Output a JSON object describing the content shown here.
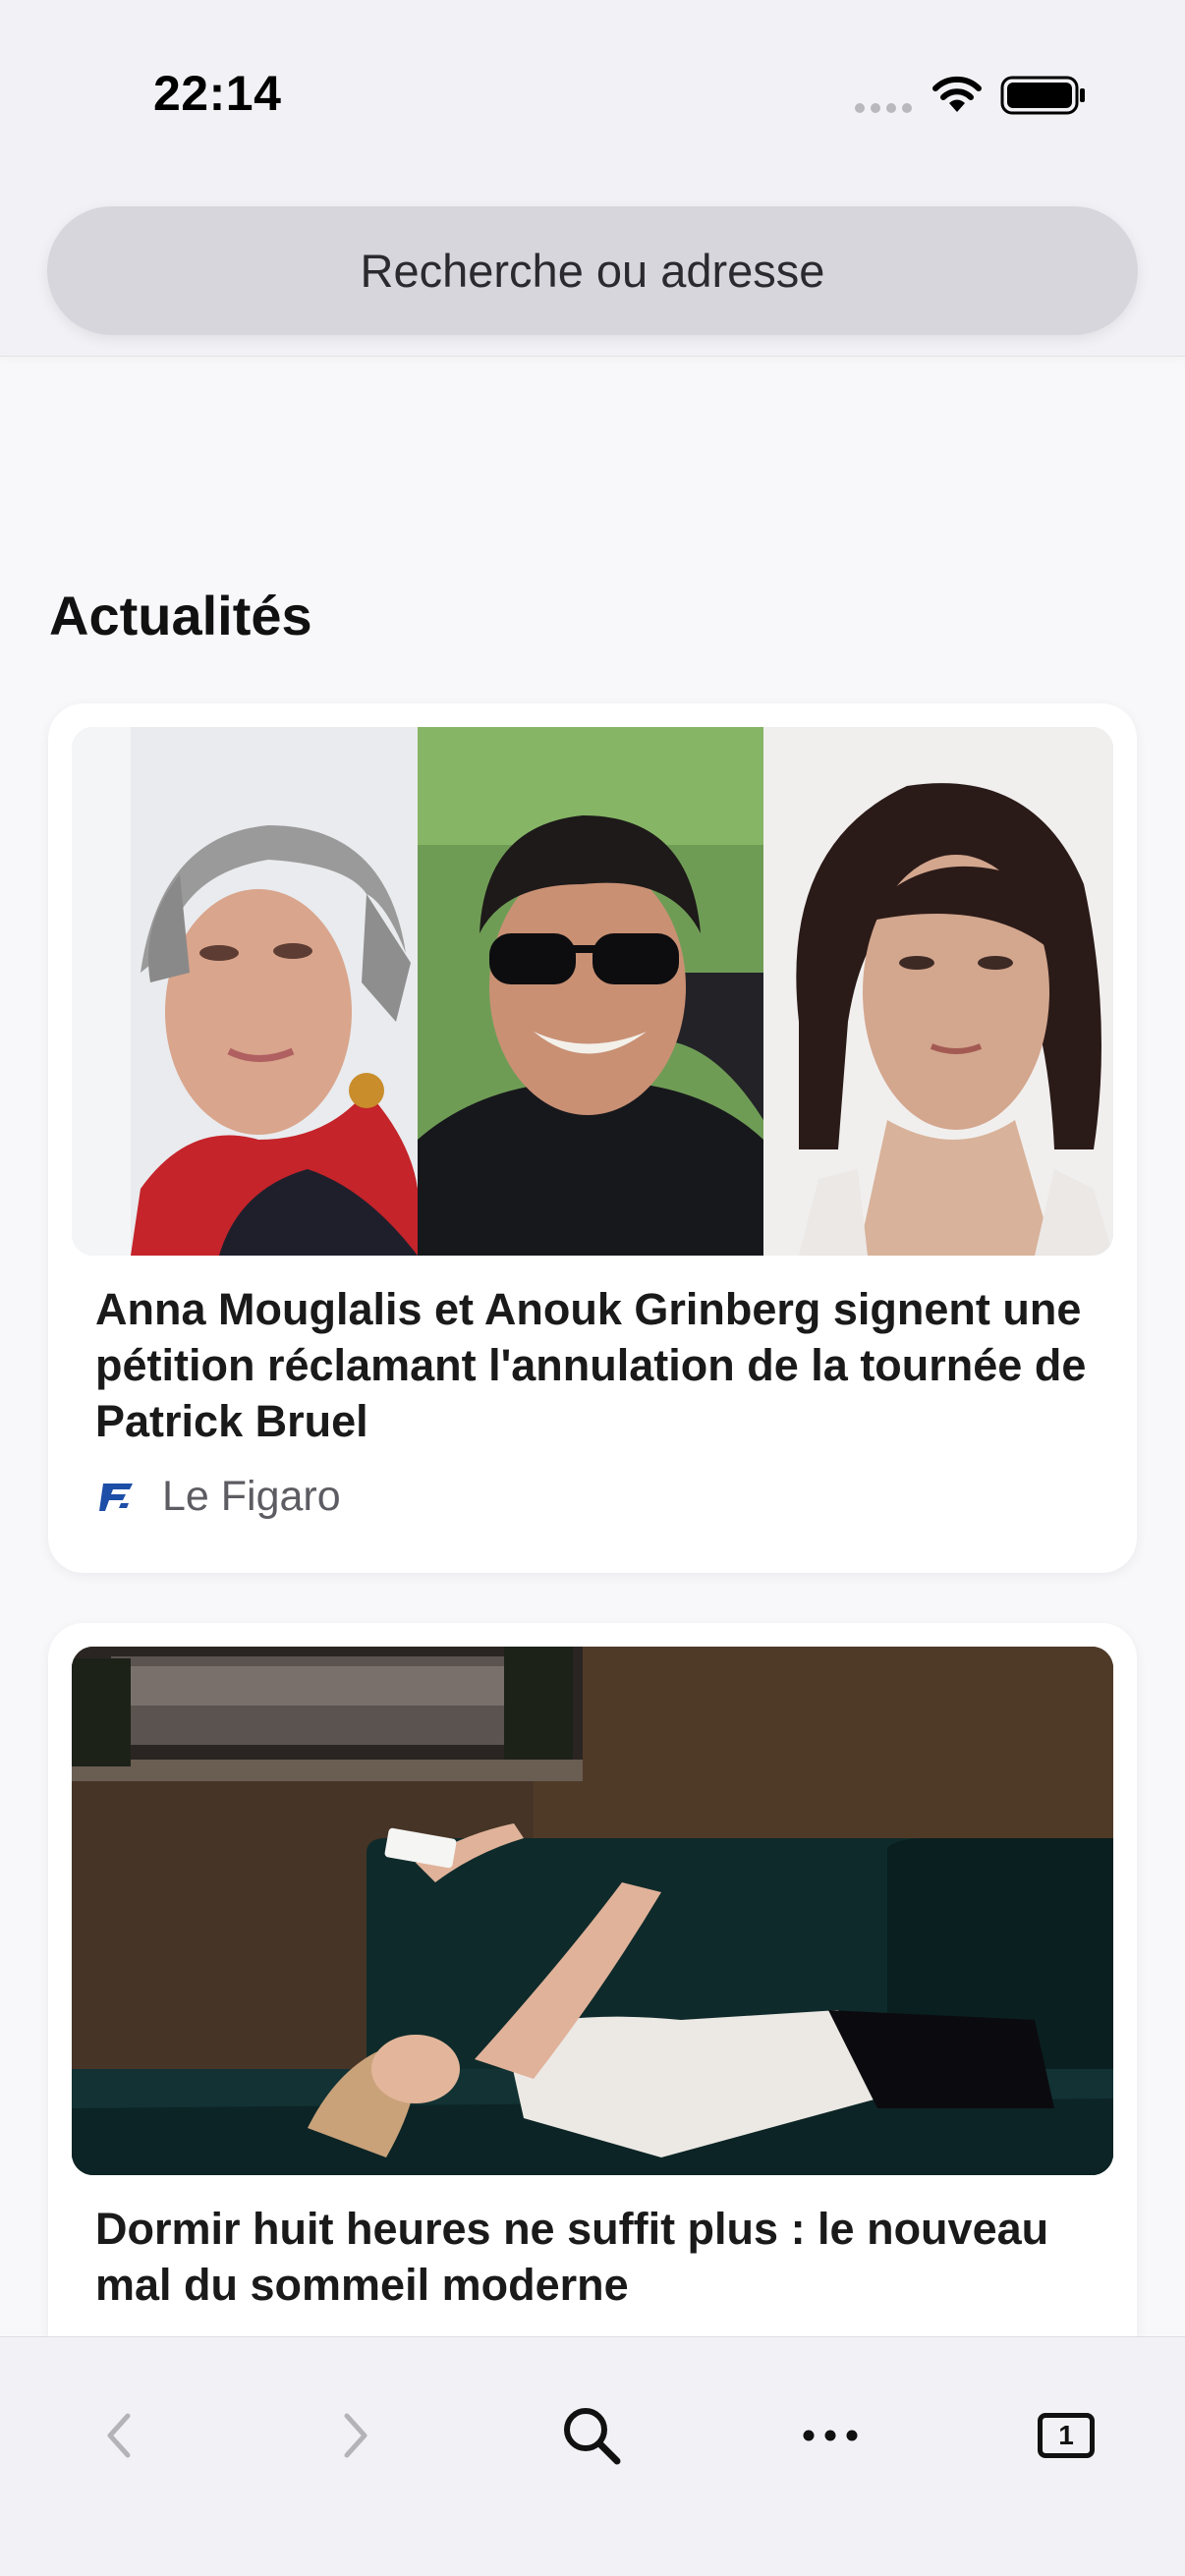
{
  "status_bar": {
    "time": "22:14",
    "icons": [
      "cellular-signal-icon",
      "wifi-icon",
      "battery-icon"
    ]
  },
  "address_bar": {
    "placeholder": "Recherche ou adresse"
  },
  "news": {
    "section_title": "Actualités",
    "articles": [
      {
        "headline": "Anna Mouglalis et Anouk Grinberg signent une pétition réclamant l'annulation de la tournée de Patrick Bruel",
        "source": "Le Figaro",
        "source_icon": "le-figaro-logo-icon",
        "image": "three-portraits-photo"
      },
      {
        "headline": "Dormir huit heures ne suffit plus : le nouveau mal du sommeil moderne",
        "image": "woman-lying-on-couch-with-phone-photo"
      }
    ]
  },
  "toolbar": {
    "buttons": [
      "back-icon",
      "forward-icon",
      "search-icon",
      "more-icon",
      "tabs-icon"
    ],
    "tab_count": "1"
  },
  "colors": {
    "background": "#f8f8fa",
    "bar_background": "#f2f2f6",
    "address_field": "#d6d6dc",
    "card": "#ffffff",
    "figaro_blue": "#1d4ea8"
  }
}
